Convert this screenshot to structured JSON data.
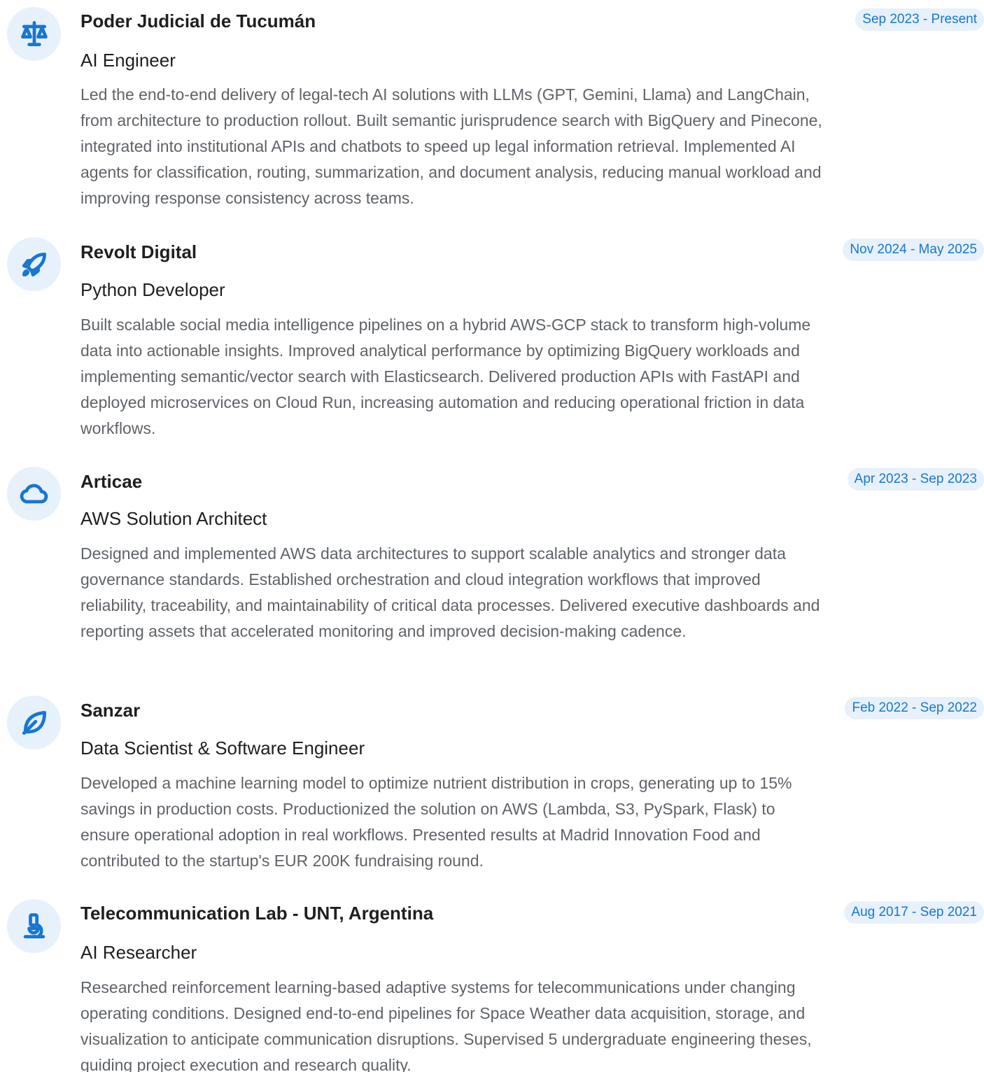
{
  "accent_color": "#1976d2",
  "icon_bg_color": "#e6f1fc",
  "experiences": [
    {
      "icon": "scale-icon",
      "company": "Poder Judicial de Tucumán",
      "role": "AI Engineer",
      "period": "Sep 2023 - Present",
      "description": "Led the end-to-end delivery of legal-tech AI solutions with LLMs (GPT, Gemini, Llama) and LangChain, from architecture to production rollout. Built semantic jurisprudence search with BigQuery and Pinecone, integrated into institutional APIs and chatbots to speed up legal information retrieval. Implemented AI agents for classification, routing, summarization, and document analysis, reducing manual workload and improving response consistency across teams."
    },
    {
      "icon": "rocket-icon",
      "company": "Revolt Digital",
      "role": "Python Developer",
      "period": "Nov 2024 - May 2025",
      "description": "Built scalable social media intelligence pipelines on a hybrid AWS-GCP stack to transform high-volume data into actionable insights. Improved analytical performance by optimizing BigQuery workloads and implementing semantic/vector search with Elasticsearch. Delivered production APIs with FastAPI and deployed microservices on Cloud Run, increasing automation and reducing operational friction in data workflows."
    },
    {
      "icon": "cloud-icon",
      "company": "Articae",
      "role": "AWS Solution Architect",
      "period": "Apr 2023 - Sep 2023",
      "description": "Designed and implemented AWS data architectures to support scalable analytics and stronger data governance standards. Established orchestration and cloud integration workflows that improved reliability, traceability, and maintainability of critical data processes. Delivered executive dashboards and reporting assets that accelerated monitoring and improved decision-making cadence."
    },
    {
      "icon": "leaf-icon",
      "company": "Sanzar",
      "role": "Data Scientist & Software Engineer",
      "period": "Feb 2022 - Sep 2022",
      "description": "Developed a machine learning model to optimize nutrient distribution in crops, generating up to 15% savings in production costs. Productionized the solution on AWS (Lambda, S3, PySpark, Flask) to ensure operational adoption in real workflows. Presented results at Madrid Innovation Food and contributed to the startup's EUR 200K fundraising round."
    },
    {
      "icon": "microscope-icon",
      "company": "Telecommunication Lab - UNT, Argentina",
      "role": "AI Researcher",
      "period": "Aug 2017 - Sep 2021",
      "description": "Researched reinforcement learning-based adaptive systems for telecommunications under changing operating conditions. Designed end-to-end pipelines for Space Weather data acquisition, storage, and visualization to anticipate communication disruptions. Supervised 5 undergraduate engineering theses, guiding project execution and research quality."
    }
  ]
}
